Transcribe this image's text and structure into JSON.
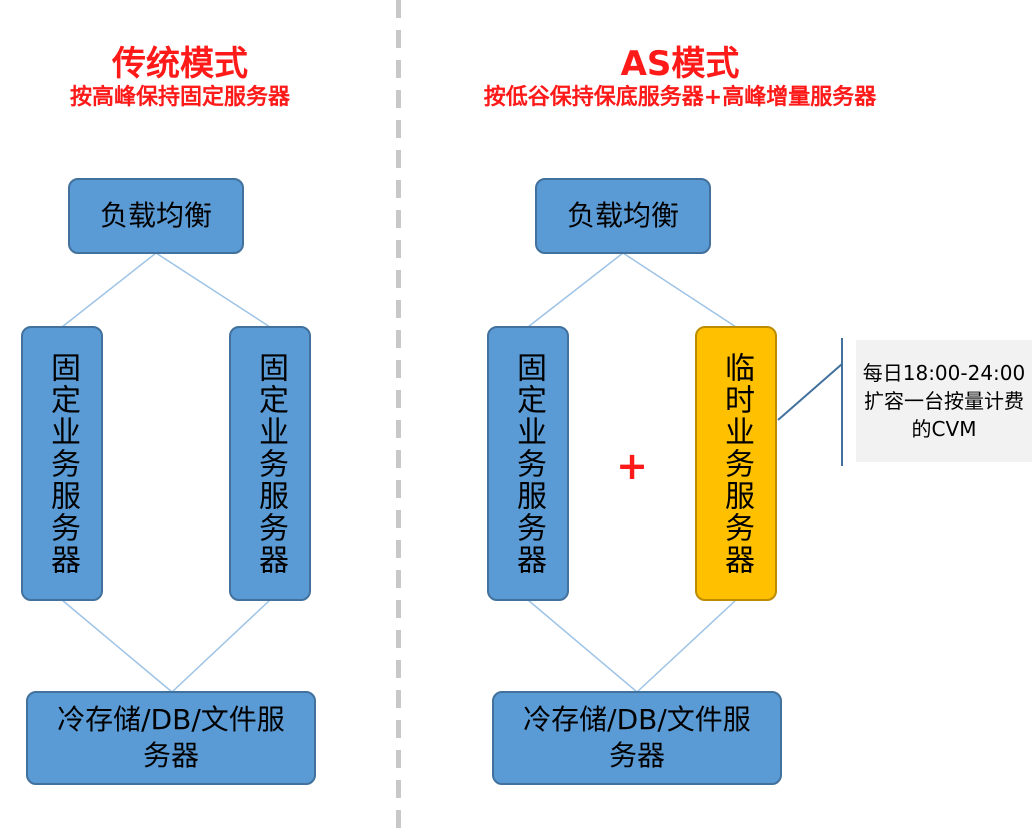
{
  "left_panel": {
    "title": "传统模式",
    "subtitle": "按高峰保持固定服务器",
    "load_balancer": "负载均衡",
    "server_1": "固定业务服务器",
    "server_2": "固定业务服务器",
    "storage": "冷存储/DB/文件服务器"
  },
  "right_panel": {
    "title": "AS模式",
    "subtitle": "按低谷保持保底服务器+高峰增量服务器",
    "load_balancer": "负载均衡",
    "server_fixed": "固定业务服务器",
    "plus": "+",
    "server_temp": "临时业务服务器",
    "callout": "每日18:00-24:00扩容一台按量计费的CVM",
    "storage": "冷存储/DB/文件服务器"
  },
  "colors": {
    "title_red": "#ff1a1a",
    "box_blue": "#5b9bd5",
    "box_blue_border": "#41719c",
    "box_orange": "#ffc000",
    "callout_bg": "#f2f2f2",
    "connector": "#9dc3e6",
    "divider": "#c8c8c8"
  }
}
